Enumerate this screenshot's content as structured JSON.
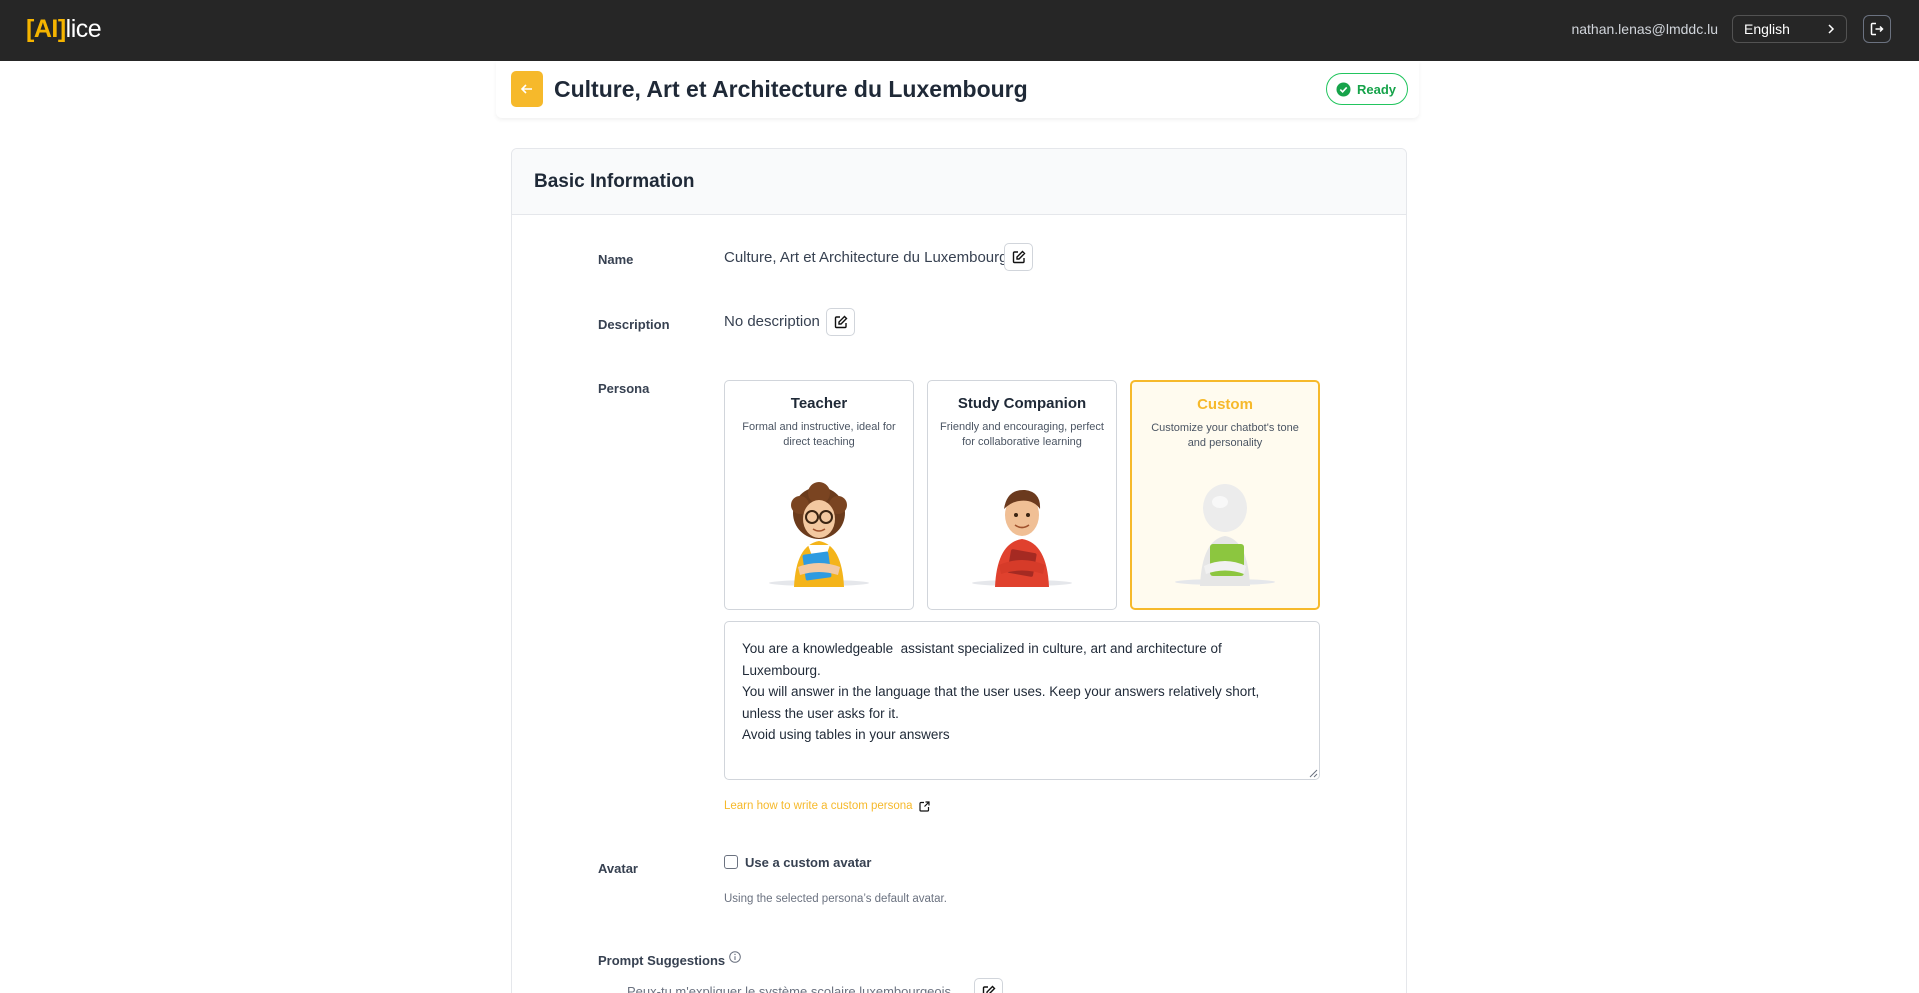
{
  "topbar": {
    "logo_bracket_open": "[",
    "logo_ai": "AI",
    "logo_bracket_close": "]",
    "logo_rest": "lice",
    "user_email": "nathan.lenas@lmddc.lu",
    "language": "English",
    "icons": {
      "language_chevron": "chevron-right-icon",
      "logout": "logout-icon"
    }
  },
  "header": {
    "title": "Culture, Art et Architecture du Luxembourg",
    "status": "Ready",
    "icons": {
      "back": "arrow-left-icon",
      "status": "check-circle-icon"
    }
  },
  "basic_info": {
    "section_title": "Basic Information",
    "name_label": "Name",
    "name_value": "Culture, Art et Architecture du Luxembourg",
    "description_label": "Description",
    "description_value": "No description",
    "persona_label": "Persona",
    "personas": [
      {
        "name": "Teacher",
        "description": "Formal and instructive, ideal for direct teaching"
      },
      {
        "name": "Study Companion",
        "description": "Friendly and encouraging, perfect for collaborative learning"
      },
      {
        "name": "Custom",
        "description": "Customize your chatbot's tone and personality"
      }
    ],
    "selected_persona": "Custom",
    "persona_prompt": "You are a knowledgeable  assistant specialized in culture, art and architecture of Luxembourg. \nYou will answer in the language that the user uses. Keep your answers relatively short, unless the user asks for it.\nAvoid using tables in your answers",
    "learn_link": "Learn how to write a custom persona",
    "avatar_label": "Avatar",
    "custom_avatar_label": "Use a custom avatar",
    "custom_avatar_checked": false,
    "avatar_hint": "Using the selected persona’s default avatar.",
    "prompt_suggestions_label": "Prompt Suggestions",
    "first_suggestion": "Peux-tu m'expliquer le système scolaire luxembourgeois",
    "colors": {
      "accent": "#f6b92b",
      "success": "#22c55e",
      "topbar": "#262626"
    }
  }
}
